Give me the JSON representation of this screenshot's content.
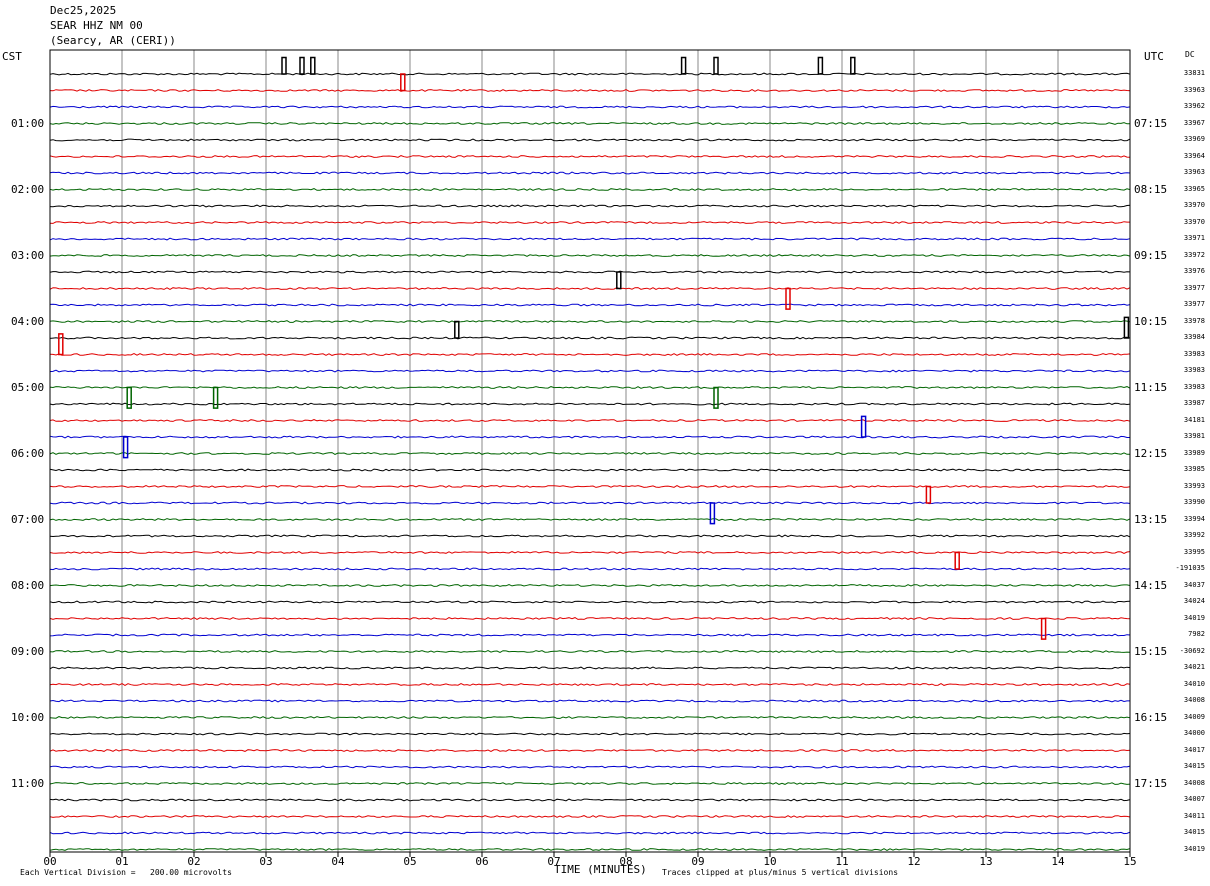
{
  "header": {
    "date": "Dec25,2025",
    "station": "SEAR HHZ NM 00",
    "location": "(Searcy, AR (CERI))"
  },
  "left_zone": "CST",
  "right_zone": "UTC",
  "dc_label": "DC",
  "footer": {
    "scale_prefix": "Each Vertical Division =",
    "scale_value": "200.00 microvolts",
    "xlabel": "TIME (MINUTES)",
    "clip_note": "Traces clipped at plus/minus 5 vertical divisions"
  },
  "chart_data": {
    "type": "line",
    "title": "SEAR HHZ NM 00",
    "xlabel": "TIME (MINUTES)",
    "xlim": [
      0,
      15
    ],
    "x_ticks": [
      "00",
      "01",
      "02",
      "03",
      "04",
      "05",
      "06",
      "07",
      "08",
      "09",
      "10",
      "11",
      "12",
      "13",
      "14",
      "15"
    ],
    "trace_interval_minutes": 15,
    "trace_colors": [
      "#000000",
      "#e00000",
      "#0000d0",
      "#006400"
    ],
    "left_hour_labels": [
      "01:00",
      "02:00",
      "03:00",
      "04:00",
      "05:00",
      "06:00",
      "07:00",
      "08:00",
      "09:00",
      "10:00",
      "11:00"
    ],
    "right_hour_labels": [
      "07:15",
      "08:15",
      "09:15",
      "10:15",
      "11:15",
      "12:15",
      "13:15",
      "14:15",
      "15:15",
      "16:15",
      "17:15"
    ],
    "dc_offsets": [
      "33831",
      "33963",
      "33962",
      "33967",
      "33969",
      "33964",
      "33963",
      "33965",
      "33970",
      "33970",
      "33971",
      "33972",
      "33976",
      "33977",
      "33977",
      "33978",
      "33984",
      "33983",
      "33983",
      "33983",
      "33987",
      "34181",
      "33981",
      "33989",
      "33985",
      "33993",
      "33990",
      "33994",
      "33992",
      "33995",
      "-191035",
      "34037",
      "34024",
      "34019",
      "7982",
      "-30692",
      "34021",
      "34010",
      "34008",
      "34009",
      "34000",
      "34017",
      "34015",
      "34008",
      "34007",
      "34011",
      "34015",
      "34019"
    ],
    "events": [
      {
        "trace": 0,
        "minute": 3.25,
        "amp": -4
      },
      {
        "trace": 0,
        "minute": 3.5,
        "amp": -4
      },
      {
        "trace": 0,
        "minute": 3.65,
        "amp": -4
      },
      {
        "trace": 0,
        "minute": 8.8,
        "amp": -4
      },
      {
        "trace": 0,
        "minute": 9.25,
        "amp": -4
      },
      {
        "trace": 0,
        "minute": 10.7,
        "amp": -4
      },
      {
        "trace": 0,
        "minute": 11.15,
        "amp": -4
      },
      {
        "trace": 1,
        "minute": 4.9,
        "amp": -4
      },
      {
        "trace": 12,
        "minute": 7.9,
        "amp": 4
      },
      {
        "trace": 13,
        "minute": 10.25,
        "amp": 5
      },
      {
        "trace": 16,
        "minute": 5.65,
        "amp": -4
      },
      {
        "trace": 16,
        "minute": 14.95,
        "amp": -5
      },
      {
        "trace": 17,
        "minute": 0.15,
        "amp": -5
      },
      {
        "trace": 19,
        "minute": 1.1,
        "amp": 5
      },
      {
        "trace": 19,
        "minute": 2.3,
        "amp": 5
      },
      {
        "trace": 19,
        "minute": 9.25,
        "amp": 5
      },
      {
        "trace": 22,
        "minute": 1.05,
        "amp": 5
      },
      {
        "trace": 22,
        "minute": 11.3,
        "amp": -5
      },
      {
        "trace": 25,
        "minute": 12.2,
        "amp": 4
      },
      {
        "trace": 26,
        "minute": 9.2,
        "amp": 5
      },
      {
        "trace": 29,
        "minute": 12.6,
        "amp": 4
      },
      {
        "trace": 33,
        "minute": 13.8,
        "amp": 5
      }
    ]
  }
}
